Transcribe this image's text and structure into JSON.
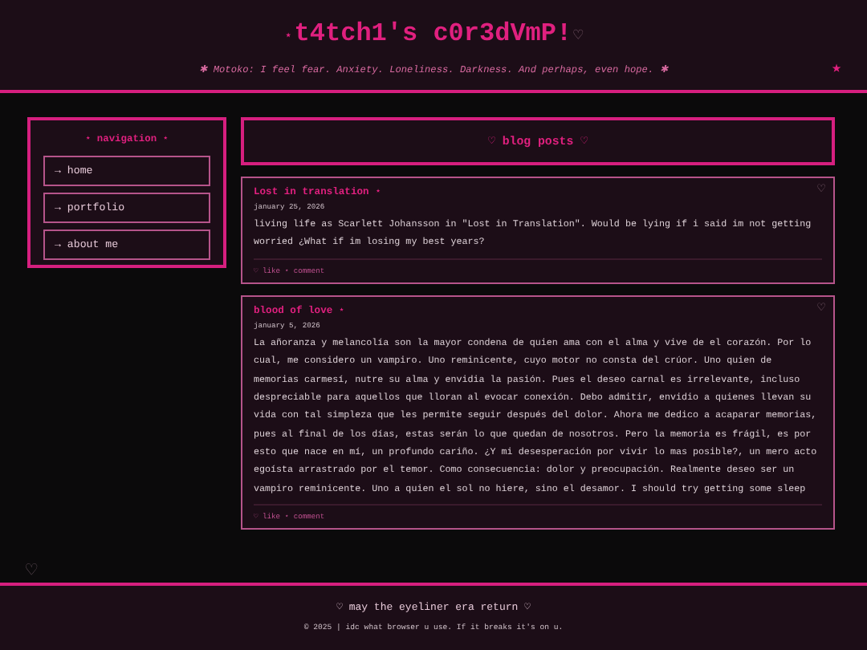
{
  "header": {
    "title_mark": "⋆",
    "title": "t4tch1's c0r3dVmP!",
    "title_heart": "♡",
    "subtitle": "✱ Motoko: I feel fear. Anxiety. Loneliness. Darkness. And perhaps, even hope. ✱",
    "corner_star": "★"
  },
  "navigation": {
    "title": "⋆ navigation ⋆",
    "items": [
      {
        "label": "→ home"
      },
      {
        "label": "→ portfolio"
      },
      {
        "label": "→ about me"
      }
    ]
  },
  "blog": {
    "title": "♡ blog posts ♡",
    "posts": [
      {
        "title": "Lost in translation ⋆",
        "date": "january 25, 2026",
        "heart": "♡",
        "body": "living life as Scarlett Johansson in \"Lost in Translation\". Would be lying if i said im not getting worried ¿What if im losing my best years?",
        "actions": "♡ like ⋆ comment"
      },
      {
        "title": "blood of love ⋆",
        "date": "january 5, 2026",
        "heart": "♡",
        "body": "La añoranza y melancolía son la mayor condena de quien ama con el alma y vive de el corazón. Por lo cual, me considero un vampiro. Uno reminicente, cuyo motor no consta del crúor. Uno quien de memorias carmesí, nutre su alma y envidia la pasión. Pues el deseo carnal es irrelevante, incluso despreciable para aquellos que lloran al evocar conexión. Debo admitir, envidio a quienes llevan su vida con tal simpleza que les permite seguir después del dolor. Ahora me dedico a acaparar memorias, pues al final de los días, estas serán lo que quedan de nosotros. Pero la memoria es frágil, es por esto que nace en mí, un profundo cariño. ¿Y mi desesperación por vivir lo mas posible?, un mero acto egoísta arrastrado por el temor. Como consecuencia: dolor y preocupación. Realmente deseo ser un vampiro reminicente. Uno a quien el sol no hiere, sino el desamor. I should try getting some sleep",
        "actions": "♡ like ⋆ comment"
      }
    ]
  },
  "corner_heart": "♡",
  "footer": {
    "tagline": "♡ may the eyeliner era return ♡",
    "copyright": "© 2025 | idc what browser u use. If it breaks it's on u."
  }
}
